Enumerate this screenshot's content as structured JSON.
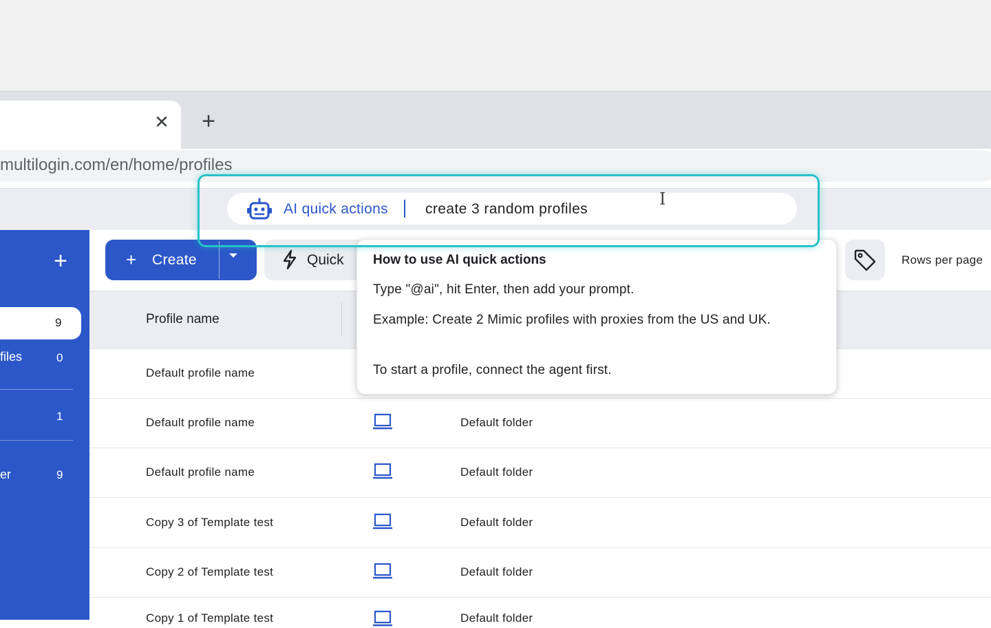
{
  "browser": {
    "tab_close_glyph": "✕",
    "new_tab_glyph": "+",
    "url": "multilogin.com/en/home/profiles"
  },
  "ai_bar": {
    "label": "AI quick actions",
    "input_value": "create 3 random profiles",
    "highlight_color": "#27c2c7"
  },
  "sidebar": {
    "add_glyph": "+",
    "items": [
      {
        "label": "",
        "count": "9",
        "active": true
      },
      {
        "label": "files",
        "count": "0"
      },
      {
        "label": "",
        "count": "1"
      },
      {
        "label": "er",
        "count": "9"
      }
    ]
  },
  "toolbar": {
    "create_label": "Create",
    "create_plus": "+",
    "quick_label": "Quick",
    "rows_per_page_label": "Rows per page"
  },
  "table": {
    "header_profile": "Profile name",
    "rows": [
      {
        "name": "Default profile name",
        "folder": ""
      },
      {
        "name": "Default profile name",
        "folder": "Default folder"
      },
      {
        "name": "Default profile name",
        "folder": "Default folder"
      },
      {
        "name": "Copy 3 of Template test",
        "folder": "Default folder"
      },
      {
        "name": "Copy 2 of Template test",
        "folder": "Default folder"
      },
      {
        "name": "Copy 1 of Template test",
        "folder": "Default folder"
      }
    ]
  },
  "tooltip": {
    "title": "How to use AI quick actions",
    "line1": "Type \"@ai\", hit Enter, then add your prompt.",
    "line2": "Example: Create 2 Mimic profiles with proxies from the US and UK.",
    "line3": "To start a profile, connect the agent first."
  },
  "colors": {
    "brand": "#2b57c9",
    "background_gray": "#ebedf1"
  },
  "icons": {
    "ai": "robot-icon",
    "quick": "lightning-icon",
    "tag": "tag-icon",
    "device": "laptop-icon",
    "cursor": "text-cursor-icon"
  }
}
